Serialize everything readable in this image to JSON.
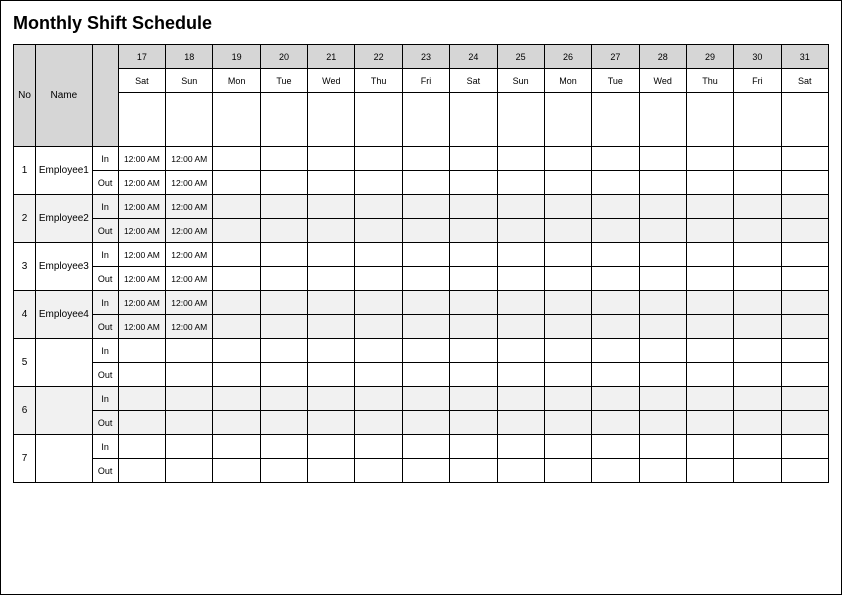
{
  "title": "Monthly Shift Schedule",
  "headers": {
    "no": "No",
    "name": "Name"
  },
  "dates": [
    "17",
    "18",
    "19",
    "20",
    "21",
    "22",
    "23",
    "24",
    "25",
    "26",
    "27",
    "28",
    "29",
    "30",
    "31"
  ],
  "dows": [
    "Sat",
    "Sun",
    "Mon",
    "Tue",
    "Wed",
    "Thu",
    "Fri",
    "Sat",
    "Sun",
    "Mon",
    "Tue",
    "Wed",
    "Thu",
    "Fri",
    "Sat"
  ],
  "inLabel": "In",
  "outLabel": "Out",
  "employees": [
    {
      "no": "1",
      "name": "Employee1",
      "shade": false,
      "in": [
        "12:00 AM",
        "12:00 AM",
        "",
        "",
        "",
        "",
        "",
        "",
        "",
        "",
        "",
        "",
        "",
        "",
        ""
      ],
      "out": [
        "12:00 AM",
        "12:00 AM",
        "",
        "",
        "",
        "",
        "",
        "",
        "",
        "",
        "",
        "",
        "",
        "",
        ""
      ]
    },
    {
      "no": "2",
      "name": "Employee2",
      "shade": true,
      "in": [
        "12:00 AM",
        "12:00 AM",
        "",
        "",
        "",
        "",
        "",
        "",
        "",
        "",
        "",
        "",
        "",
        "",
        ""
      ],
      "out": [
        "12:00 AM",
        "12:00 AM",
        "",
        "",
        "",
        "",
        "",
        "",
        "",
        "",
        "",
        "",
        "",
        "",
        ""
      ]
    },
    {
      "no": "3",
      "name": "Employee3",
      "shade": false,
      "in": [
        "12:00 AM",
        "12:00 AM",
        "",
        "",
        "",
        "",
        "",
        "",
        "",
        "",
        "",
        "",
        "",
        "",
        ""
      ],
      "out": [
        "12:00 AM",
        "12:00 AM",
        "",
        "",
        "",
        "",
        "",
        "",
        "",
        "",
        "",
        "",
        "",
        "",
        ""
      ]
    },
    {
      "no": "4",
      "name": "Employee4",
      "shade": true,
      "in": [
        "12:00 AM",
        "12:00 AM",
        "",
        "",
        "",
        "",
        "",
        "",
        "",
        "",
        "",
        "",
        "",
        "",
        ""
      ],
      "out": [
        "12:00 AM",
        "12:00 AM",
        "",
        "",
        "",
        "",
        "",
        "",
        "",
        "",
        "",
        "",
        "",
        "",
        ""
      ]
    },
    {
      "no": "5",
      "name": "",
      "shade": false,
      "in": [
        "",
        "",
        "",
        "",
        "",
        "",
        "",
        "",
        "",
        "",
        "",
        "",
        "",
        "",
        ""
      ],
      "out": [
        "",
        "",
        "",
        "",
        "",
        "",
        "",
        "",
        "",
        "",
        "",
        "",
        "",
        "",
        ""
      ]
    },
    {
      "no": "6",
      "name": "",
      "shade": true,
      "in": [
        "",
        "",
        "",
        "",
        "",
        "",
        "",
        "",
        "",
        "",
        "",
        "",
        "",
        "",
        ""
      ],
      "out": [
        "",
        "",
        "",
        "",
        "",
        "",
        "",
        "",
        "",
        "",
        "",
        "",
        "",
        "",
        ""
      ]
    },
    {
      "no": "7",
      "name": "",
      "shade": false,
      "in": [
        "",
        "",
        "",
        "",
        "",
        "",
        "",
        "",
        "",
        "",
        "",
        "",
        "",
        "",
        ""
      ],
      "out": [
        "",
        "",
        "",
        "",
        "",
        "",
        "",
        "",
        "",
        "",
        "",
        "",
        "",
        "",
        ""
      ]
    }
  ]
}
